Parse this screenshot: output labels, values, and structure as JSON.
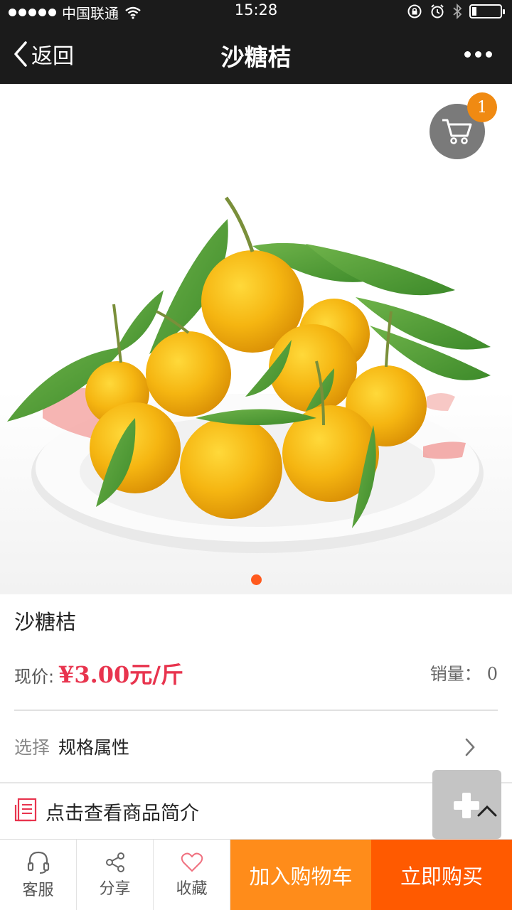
{
  "status_bar": {
    "carrier": "中国联通",
    "time": "15:28"
  },
  "nav": {
    "back_label": "返回",
    "title": "沙糖桔"
  },
  "cart": {
    "badge_count": "1"
  },
  "product": {
    "name": "沙糖桔",
    "price_label": "现价:",
    "price_value": "¥3.00元/斤",
    "sales_label": "销量：",
    "sales_value": "0"
  },
  "spec": {
    "label": "选择",
    "value": "规格属性"
  },
  "intro": {
    "text": "点击查看商品简介"
  },
  "bottom_bar": {
    "service_label": "客服",
    "share_label": "分享",
    "favorite_label": "收藏",
    "add_to_cart_label": "加入购物车",
    "buy_now_label": "立即购买"
  },
  "colors": {
    "nav_bg": "#1b1b1b",
    "price": "#e8344e",
    "add_to_cart_bg": "#ff8c1a",
    "buy_now_bg": "#ff5a00",
    "badge": "#f08a12"
  }
}
